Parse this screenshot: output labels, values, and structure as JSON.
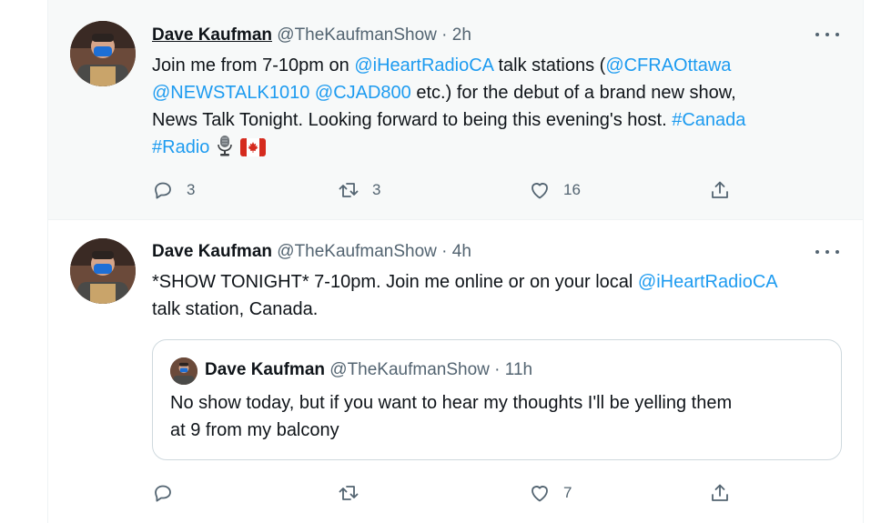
{
  "tweets": [
    {
      "name": "Dave Kaufman",
      "handle": "@TheKaufmanShow",
      "sep": "·",
      "time": "2h",
      "segments": [
        {
          "t": "Join me from 7-10pm on "
        },
        {
          "t": "@iHeartRadioCA",
          "link": true
        },
        {
          "t": " talk stations ("
        },
        {
          "t": "@CFRAOttawa",
          "link": true
        },
        {
          "br": true
        },
        {
          "t": "@NEWSTALK1010",
          "link": true
        },
        {
          "t": " "
        },
        {
          "t": "@CJAD800",
          "link": true
        },
        {
          "t": " etc.) for the debut of a brand new show,"
        },
        {
          "br": true
        },
        {
          "t": "News Talk Tonight. Looking forward to being this evening's host. "
        },
        {
          "t": "#Canada",
          "link": true
        },
        {
          "br": true
        },
        {
          "t": "#Radio",
          "link": true
        }
      ],
      "emojis": [
        "microphone-emoji",
        "canada-flag-emoji"
      ],
      "replies": "3",
      "retweets": "3",
      "likes": "16"
    },
    {
      "name": "Dave Kaufman",
      "handle": "@TheKaufmanShow",
      "sep": "·",
      "time": "4h",
      "segments": [
        {
          "t": "*SHOW TONIGHT* 7-10pm. Join me online or on your local "
        },
        {
          "t": "@iHeartRadioCA",
          "link": true
        },
        {
          "br": true
        },
        {
          "t": "talk station, Canada."
        }
      ],
      "quote": {
        "name": "Dave Kaufman",
        "handle": "@TheKaufmanShow",
        "sep": "·",
        "time": "11h",
        "text_line1": "No show today, but if you want to hear my thoughts I'll be yelling them",
        "text_line2": "at 9 from my balcony"
      },
      "replies": "",
      "retweets": "",
      "likes": "7"
    }
  ],
  "icons": {
    "reply": "reply-icon",
    "retweet": "retweet-icon",
    "like": "heart-icon",
    "share": "share-icon",
    "more": "more-icon"
  },
  "colors": {
    "link": "#1d9bf0",
    "muted": "#536471",
    "hover_bg": "#f7f9f9"
  }
}
